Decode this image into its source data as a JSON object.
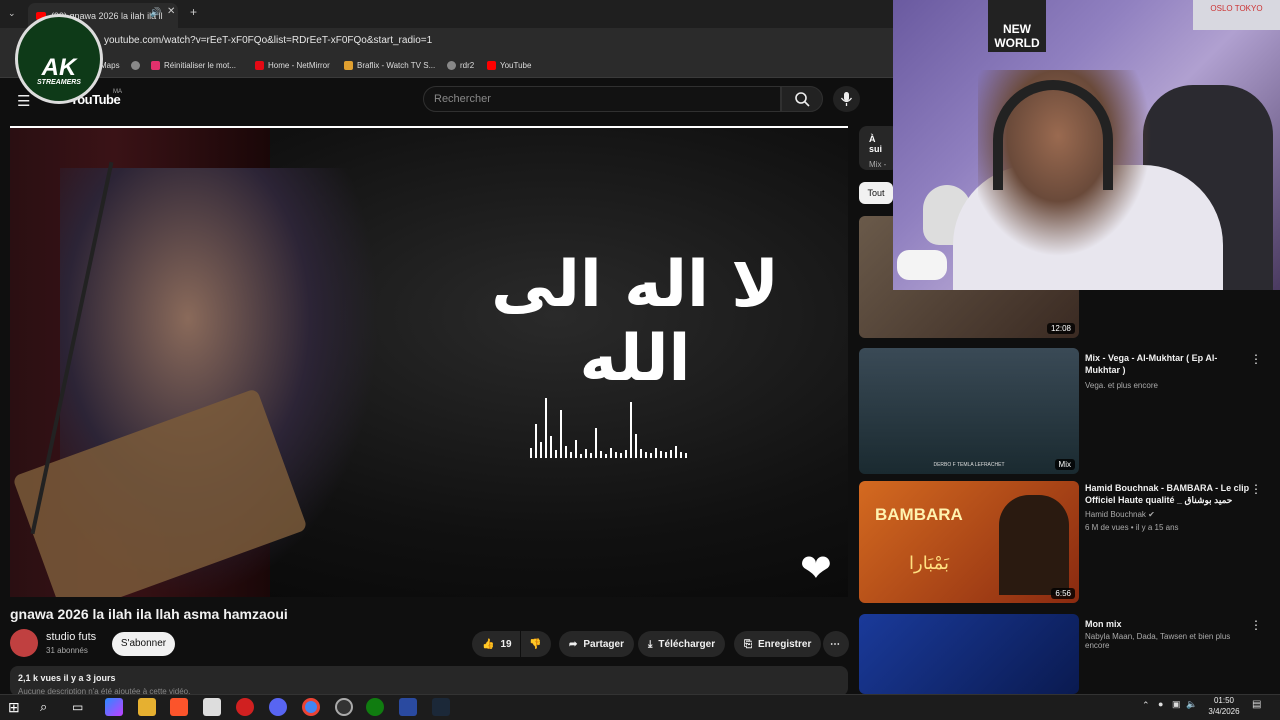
{
  "browser": {
    "tab_title": "(99) gnawa 2026 la ilah ila ll",
    "url": "youtube.com/watch?v=rEeT-xF0FQo&list=RDrEeT-xF0FQo&start_radio=1",
    "bookmarks": [
      {
        "label": "Maps",
        "color": "#4caf50"
      },
      {
        "label": "",
        "color": "#888888"
      },
      {
        "label": "Réinitialiser le mot...",
        "color": "#e1306c"
      },
      {
        "label": "Home - NetMirror",
        "color": "#e50914"
      },
      {
        "label": "Braflix - Watch TV S...",
        "color": "#e0a030"
      },
      {
        "label": "rdr2",
        "color": "#888888"
      },
      {
        "label": "YouTube",
        "color": "#ff0000"
      }
    ]
  },
  "logo": {
    "big": "AK",
    "small": "STREAMERS"
  },
  "youtube": {
    "brand": "YouTube",
    "region": "MA",
    "search_placeholder": "Rechercher"
  },
  "video": {
    "overlay_text": "لا اله الى الله",
    "title": "gnawa 2026 la ilah ila llah asma hamzaoui",
    "channel": "studio futs",
    "subscribers": "31 abonnés",
    "subscribe_label": "S'abonner",
    "likes": "19",
    "share_label": "Partager",
    "download_label": "Télécharger",
    "save_label": "Enregistrer",
    "views_date": "2,1 k vues  il y a 3 jours",
    "description_hint": "Aucune description n'a été ajoutée à cette vidéo."
  },
  "sidebar": {
    "up_next": "À sui",
    "up_next_sub": "Mix - g",
    "chip": "Tout",
    "items": [
      {
        "title": "",
        "meta1": "",
        "meta2": "",
        "duration": "12:08",
        "color": "#5a4a3a"
      },
      {
        "title": "Mix - Vega - Al-Mukhtar ( Ep Al-Mukhtar )",
        "meta1": "Vega. et plus encore",
        "meta2": "",
        "duration": "Mix",
        "color": "#2a3a44",
        "caption": "DERBO F TEMLA LEFRACHET"
      },
      {
        "title": "Hamid Bouchnak - BAMBARA - Le clip Officiel Haute qualité _ حميد بوشناق",
        "meta1": "Hamid Bouchnak",
        "meta2": "6 M de vues • il y a 15 ans",
        "duration": "6:56",
        "color": "#c0501a",
        "thumb_text": "BAMBARA",
        "thumb_arabic": "بَمْبَارا"
      },
      {
        "title": "Mon mix",
        "meta1": "Nabyla Maan, Dada, Tawsen et bien plus encore",
        "meta2": "",
        "duration": "",
        "color": "#1a3a8a"
      }
    ]
  },
  "webcam": {
    "poster": "NEW WORLD",
    "poster2": "OSLO  TOKYO"
  },
  "taskbar": {
    "time": "01:50",
    "date": "3/4/2026"
  }
}
